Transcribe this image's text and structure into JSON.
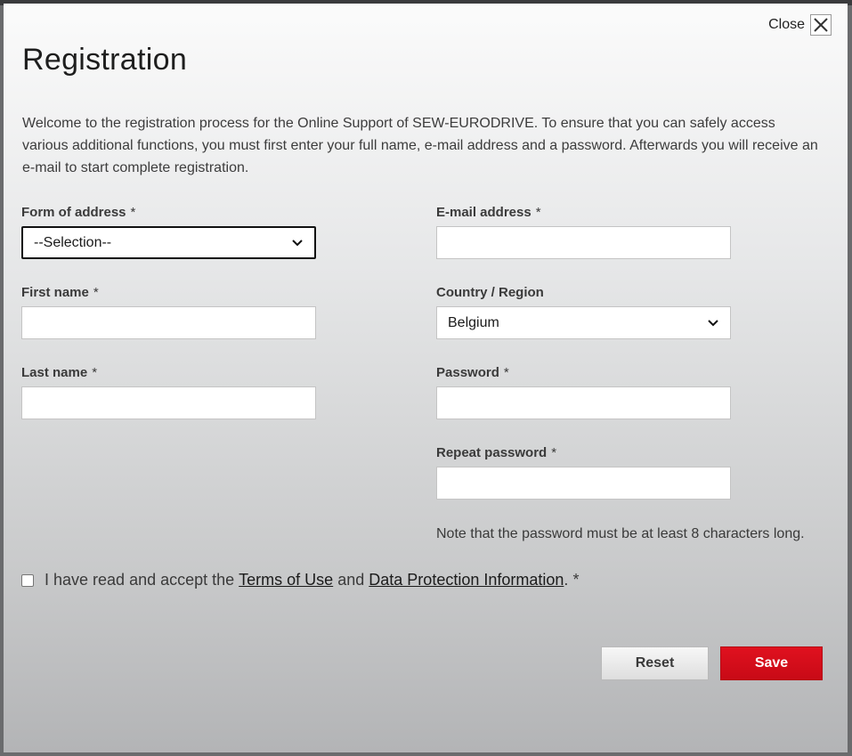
{
  "dialog": {
    "title": "Registration",
    "close_label": "Close",
    "intro": "Welcome to the registration process for the Online Support of SEW-EURODRIVE. To ensure that you can safely access various additional functions, you must first enter your full name, e-mail address and a password. Afterwards you will receive an e-mail to start complete registration."
  },
  "form": {
    "form_of_address": {
      "label": "Form of address",
      "required": "*",
      "value": "--Selection--"
    },
    "first_name": {
      "label": "First name",
      "required": "*",
      "value": ""
    },
    "last_name": {
      "label": "Last name",
      "required": "*",
      "value": ""
    },
    "email": {
      "label": "E-mail address",
      "required": "*",
      "value": ""
    },
    "country": {
      "label": "Country / Region",
      "value": "Belgium"
    },
    "password": {
      "label": "Password",
      "required": "*",
      "value": ""
    },
    "repeat_password": {
      "label": "Repeat password",
      "required": "*",
      "value": ""
    },
    "password_note": "Note that the password must be at least 8 characters long.",
    "consent": {
      "prefix": "I have read and accept the",
      "terms_link": "Terms of Use",
      "middle": "and",
      "privacy_link": "Data Protection Information",
      "suffix": ".",
      "required": "*",
      "checked": false
    }
  },
  "buttons": {
    "reset": "Reset",
    "save": "Save"
  },
  "colors": {
    "accent_save": "#d40d1a",
    "focus_border": "#111111"
  },
  "icons": {
    "close": "close-icon",
    "select": "chevron-down-icon"
  }
}
